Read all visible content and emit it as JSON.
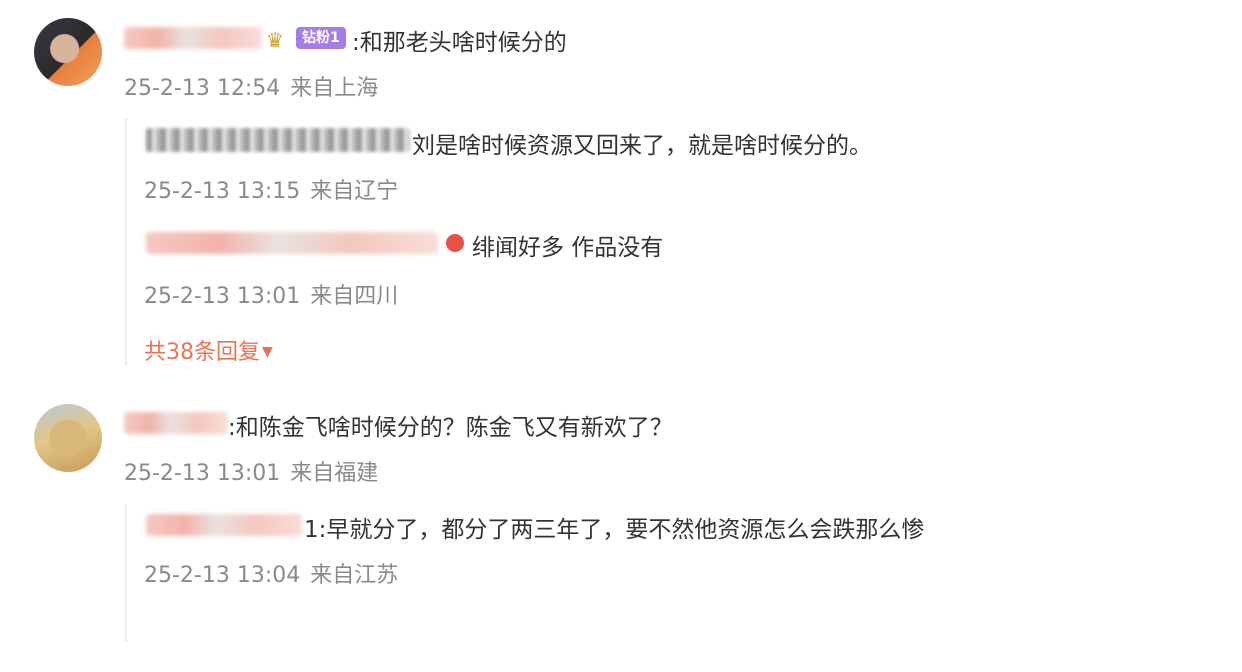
{
  "comments": [
    {
      "text": ":和那老头啥时候分的",
      "badge": "钻粉1",
      "badge_icon": "crown-icon",
      "date": "25-2-13 12:54",
      "location": "来自上海",
      "replies": [
        {
          "text": "刘是啥时候资源又回来了，就是啥时候分的。",
          "date": "25-2-13 13:15",
          "location": "来自辽宁"
        },
        {
          "text": "绯闻好多 作品没有",
          "date": "25-2-13 13:01",
          "location": "来自四川"
        }
      ],
      "more_replies": "共38条回复"
    },
    {
      "text": ":和陈金飞啥时候分的？陈金飞又有新欢了？",
      "date": "25-2-13 13:01",
      "location": "来自福建",
      "replies": [
        {
          "text": "1:早就分了，都分了两三年了，要不然他资源怎么会跌那么惨",
          "date": "25-2-13 13:04",
          "location": "来自江苏"
        }
      ]
    }
  ],
  "colors": {
    "text": "#333333",
    "meta": "#8a8a8a",
    "link": "#eb7350",
    "badge": "#a57de8"
  }
}
